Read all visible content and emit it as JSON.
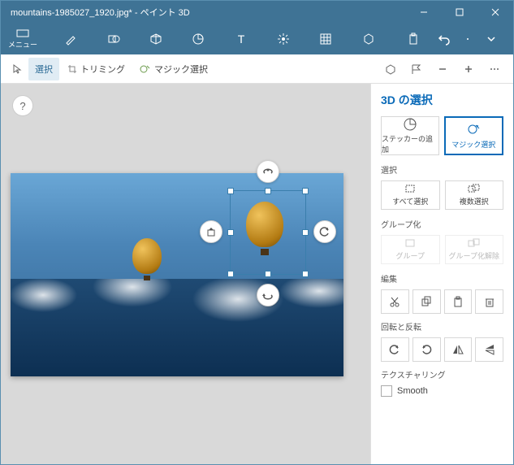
{
  "window": {
    "title": "mountains-1985027_1920.jpg* - ペイント 3D"
  },
  "ribbon": {
    "menu_label": "メニュー"
  },
  "toolbar": {
    "select": "選択",
    "trimming": "トリミング",
    "magic_select": "マジック選択"
  },
  "sidepanel": {
    "title": "3D の選択",
    "add_sticker": "ステッカーの追加",
    "magic_select": "マジック選択",
    "section_select": "選択",
    "select_all": "すべて選択",
    "multi_select": "複数選択",
    "section_group": "グループ化",
    "group": "グループ",
    "ungroup": "グループ化解除",
    "section_edit": "編集",
    "section_rotate": "回転と反転",
    "section_texture": "テクスチャリング",
    "smooth": "Smooth"
  }
}
